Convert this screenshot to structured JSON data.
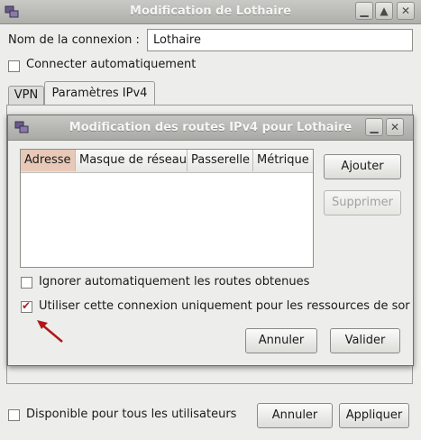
{
  "main_window": {
    "title": "Modification de Lothaire",
    "connection_name_label": "Nom de la connexion :",
    "connection_name_value": "Lothaire",
    "auto_connect_label": "Connecter automatiquement",
    "tabs": [
      {
        "label": "VPN"
      },
      {
        "label": "Paramètres IPv4"
      }
    ],
    "available_all_users_label": "Disponible pour tous les utilisateurs",
    "cancel_label": "Annuler",
    "apply_label": "Appliquer"
  },
  "routes_dialog": {
    "title": "Modification des routes IPv4 pour Lothaire",
    "columns": [
      "Adresse",
      "Masque de réseau",
      "Passerelle",
      "Métrique"
    ],
    "rows": [],
    "add_label": "Ajouter",
    "delete_label": "Supprimer",
    "ignore_routes_label": "Ignorer automatiquement les routes obtenues",
    "ignore_routes_checked": false,
    "use_only_for_resources_label": "Utiliser cette connexion uniquement pour les ressources de sor",
    "use_only_for_resources_checked": true,
    "cancel_label": "Annuler",
    "validate_label": "Valider"
  },
  "colors": {
    "titlebar": "#b8b8b4",
    "selected_column_header": "#e8c9b8",
    "annotation_arrow": "#b01818"
  },
  "icons": [
    "network-connection-icon",
    "minimize-icon",
    "maximize-icon",
    "close-icon",
    "annotation-arrow-icon"
  ]
}
